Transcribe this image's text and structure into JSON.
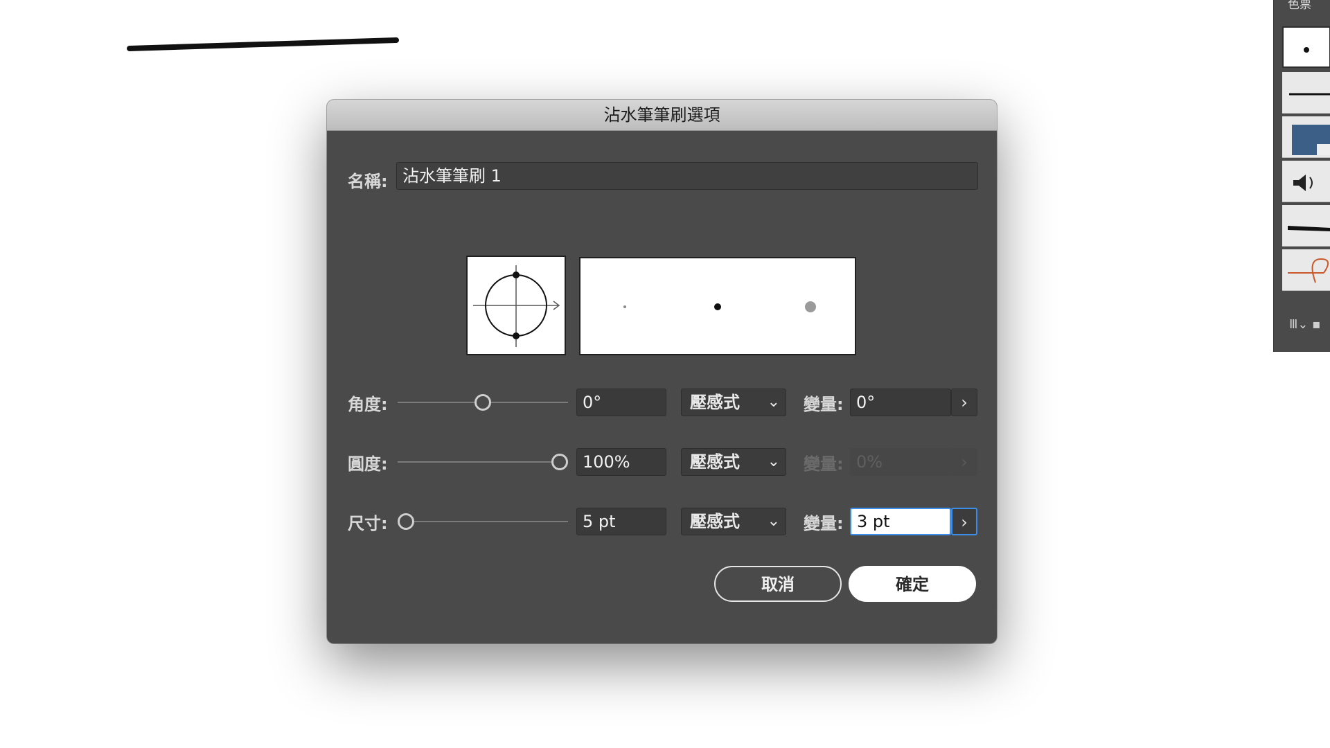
{
  "dialog": {
    "title": "沾水筆筆刷選項",
    "name_label": "名稱:",
    "name_value": "沾水筆筆刷 1",
    "rows": [
      {
        "label": "角度:",
        "value": "0°",
        "mode": "壓感式",
        "variation_label": "變量:",
        "variation_value": "0°",
        "enabled": true
      },
      {
        "label": "圓度:",
        "value": "100%",
        "mode": "壓感式",
        "variation_label": "變量:",
        "variation_value": "0%",
        "enabled": false
      },
      {
        "label": "尺寸:",
        "value": "5 pt",
        "mode": "壓感式",
        "variation_label": "變量:",
        "variation_value": "3 pt",
        "enabled": true
      }
    ],
    "sliders": {
      "angle_fraction": 0.5,
      "roundness_fraction": 1.0,
      "size_fraction": 0.0
    },
    "cancel_label": "取消",
    "ok_label": "確定"
  },
  "brush_panel": {
    "title": "色票",
    "footer_icons": [
      "library-icon",
      "chevron-down-icon",
      "new-brush-icon"
    ]
  },
  "colors": {
    "dialog_bg": "#4a4a4a",
    "focus_ring": "#3d8ee8",
    "titlebar": "#c8c8c8"
  }
}
